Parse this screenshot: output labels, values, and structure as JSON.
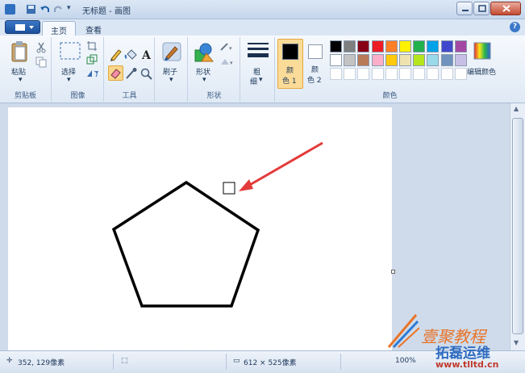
{
  "window": {
    "title": "无标题 - 画图"
  },
  "tabs": [
    {
      "label": "主页",
      "active": true
    },
    {
      "label": "查看",
      "active": false
    }
  ],
  "help_label": "?",
  "ribbon": {
    "clipboard": {
      "paste_label": "粘贴",
      "group_label": "剪贴板"
    },
    "image": {
      "select_label": "选择",
      "group_label": "图像"
    },
    "tools": {
      "group_label": "工具"
    },
    "brushes": {
      "label": "刷子"
    },
    "shapes": {
      "label": "形状",
      "group_label": "形状"
    },
    "size": {
      "label_line1": "粗",
      "label_line2": "细"
    },
    "colors": {
      "color1_line1": "颜",
      "color1_line2": "色 1",
      "color2_line1": "颜",
      "color2_line2": "色 2",
      "edit_label": "编辑颜色",
      "group_label": "颜色",
      "color1_value": "#000000",
      "color2_value": "#ffffff",
      "palette_row1": [
        "#000000",
        "#7f7f7f",
        "#880015",
        "#ed1c24",
        "#ff7f27",
        "#fff200",
        "#22b14c",
        "#00a2e8",
        "#3f48cc",
        "#a349a4"
      ],
      "palette_row2": [
        "#ffffff",
        "#c3c3c3",
        "#b97a57",
        "#ffaec9",
        "#ffc90e",
        "#efe4b0",
        "#b5e61d",
        "#99d9ea",
        "#7092be",
        "#c8bfe7"
      ]
    }
  },
  "status": {
    "cursor_pos": "352, 129像素",
    "canvas_size": "612 × 525像素",
    "zoom": "100%"
  },
  "watermark": {
    "line1": "壹聚教程",
    "line2": "拓磊运维",
    "url": "www.tlltd.cn"
  }
}
